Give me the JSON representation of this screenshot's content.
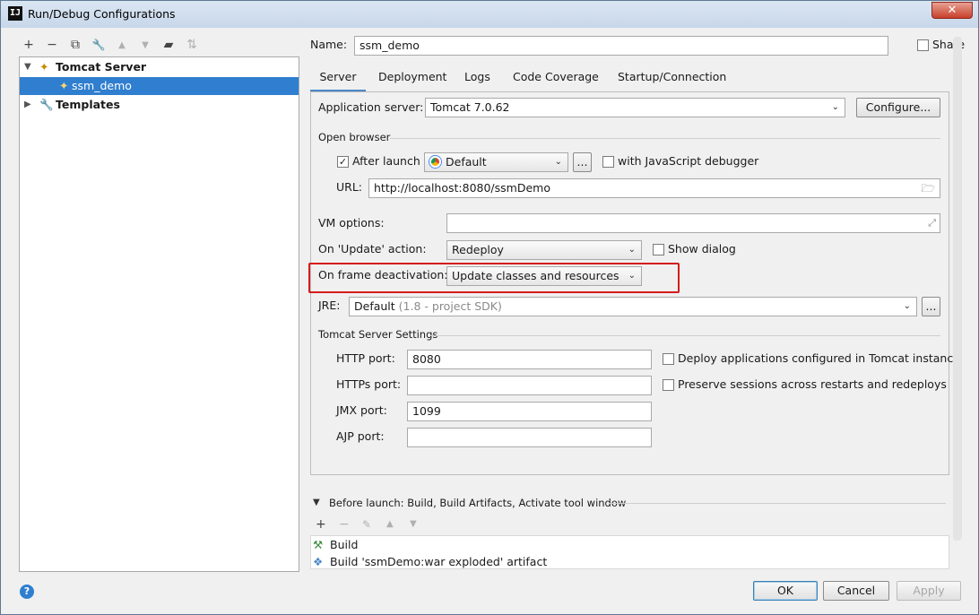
{
  "window": {
    "title": "Run/Debug Configurations",
    "app_icon_text": "IJ",
    "close_glyph": "✕"
  },
  "toolbar": {
    "items": [
      {
        "name": "add-icon",
        "glyph": "+"
      },
      {
        "name": "remove-icon",
        "glyph": "−"
      },
      {
        "name": "copy-icon",
        "glyph": "⧉"
      },
      {
        "name": "wrench-icon",
        "glyph": "🔧"
      },
      {
        "name": "move-up-icon",
        "glyph": "▲"
      },
      {
        "name": "move-down-icon",
        "glyph": "▼"
      },
      {
        "name": "folder-icon",
        "glyph": "▰"
      },
      {
        "name": "sort-icon",
        "glyph": "⇅"
      }
    ]
  },
  "tree": {
    "items": [
      {
        "label": "Tomcat Server",
        "expanded": true
      },
      {
        "label": "ssm_demo",
        "selected": true
      },
      {
        "label": "Templates",
        "expanded": false
      }
    ]
  },
  "name_label": "Name:",
  "name_value": "ssm_demo",
  "share_label": "Share",
  "tabs": [
    "Server",
    "Deployment",
    "Logs",
    "Code Coverage",
    "Startup/Connection"
  ],
  "server": {
    "app_server_label": "Application server:",
    "app_server_value": "Tomcat 7.0.62",
    "configure_label": "Configure...",
    "open_browser_title": "Open browser",
    "after_launch_label": "After launch",
    "browser_value": "Default",
    "more_label": "...",
    "js_debugger_label": "with JavaScript debugger",
    "url_label": "URL:",
    "url_value": "http://localhost:8080/ssmDemo",
    "vm_options_label": "VM options:",
    "on_update_label": "On 'Update' action:",
    "on_update_value": "Redeploy",
    "show_dialog_label": "Show dialog",
    "on_frame_label": "On frame deactivation:",
    "on_frame_value": "Update classes and resources",
    "jre_label": "JRE:",
    "jre_value": "Default",
    "jre_hint": "(1.8 - project SDK)",
    "tomcat_settings_title": "Tomcat Server Settings",
    "http_port_label": "HTTP port:",
    "http_port_value": "8080",
    "https_port_label": "HTTPs port:",
    "https_port_value": "",
    "jmx_port_label": "JMX port:",
    "jmx_port_value": "1099",
    "ajp_port_label": "AJP port:",
    "ajp_port_value": "",
    "deploy_apps_label": "Deploy applications configured in Tomcat instance",
    "preserve_sessions_label": "Preserve sessions across restarts and redeploys"
  },
  "before_launch": {
    "title": "Before launch: Build, Build Artifacts, Activate tool window",
    "items": [
      "Build",
      "Build 'ssmDemo:war exploded' artifact"
    ]
  },
  "footer": {
    "ok_label": "OK",
    "cancel_label": "Cancel",
    "apply_label": "Apply",
    "help_glyph": "?"
  },
  "colors": {
    "selection": "#2f7ecf",
    "highlight_box": "#d51c1c"
  }
}
